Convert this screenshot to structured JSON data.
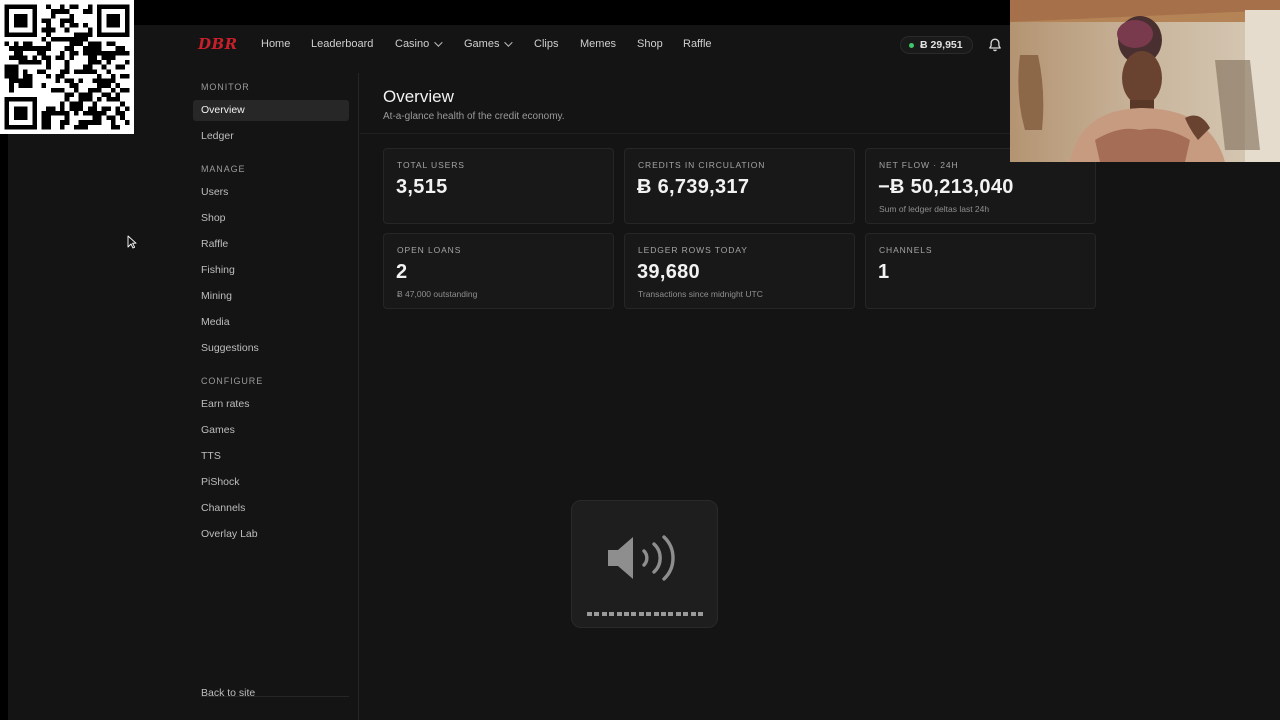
{
  "brand": {
    "logo_text": "DBR",
    "accent": "#c8202a"
  },
  "nav": {
    "items": [
      {
        "label": "Home"
      },
      {
        "label": "Leaderboard"
      },
      {
        "label": "Casino"
      },
      {
        "label": "Games"
      },
      {
        "label": "Clips"
      },
      {
        "label": "Memes"
      },
      {
        "label": "Shop"
      },
      {
        "label": "Raffle"
      }
    ],
    "balance": "Ƀ 29,951",
    "balance_dot_color": "#3ec66b"
  },
  "sidebar": {
    "sections": [
      {
        "title": "MONITOR",
        "items": [
          "Overview",
          "Ledger"
        ]
      },
      {
        "title": "MANAGE",
        "items": [
          "Users",
          "Shop",
          "Raffle",
          "Fishing",
          "Mining",
          "Media",
          "Suggestions"
        ]
      },
      {
        "title": "CONFIGURE",
        "items": [
          "Earn rates",
          "Games",
          "TTS",
          "PiShock",
          "Channels",
          "Overlay Lab"
        ]
      }
    ],
    "active_item": "Overview",
    "footer_link": "Back to site"
  },
  "main": {
    "title": "Overview",
    "subtitle": "At-a-glance health of the credit economy.",
    "cards": [
      {
        "label": "TOTAL USERS",
        "value": "3,515",
        "note": ""
      },
      {
        "label": "CREDITS IN CIRCULATION",
        "value": "Ƀ 6,739,317",
        "note": ""
      },
      {
        "label": "NET FLOW · 24H",
        "value": "−Ƀ 50,213,040",
        "note": "Sum of ledger deltas last 24h"
      },
      {
        "label": "OPEN LOANS",
        "value": "2",
        "note": "Ƀ 47,000 outstanding"
      },
      {
        "label": "LEDGER ROWS TODAY",
        "value": "39,680",
        "note": "Transactions since midnight UTC"
      },
      {
        "label": "CHANNELS",
        "value": "1",
        "note": ""
      }
    ]
  },
  "volume_hud": {
    "icon": "speaker-volume-icon",
    "level": 1.0
  }
}
